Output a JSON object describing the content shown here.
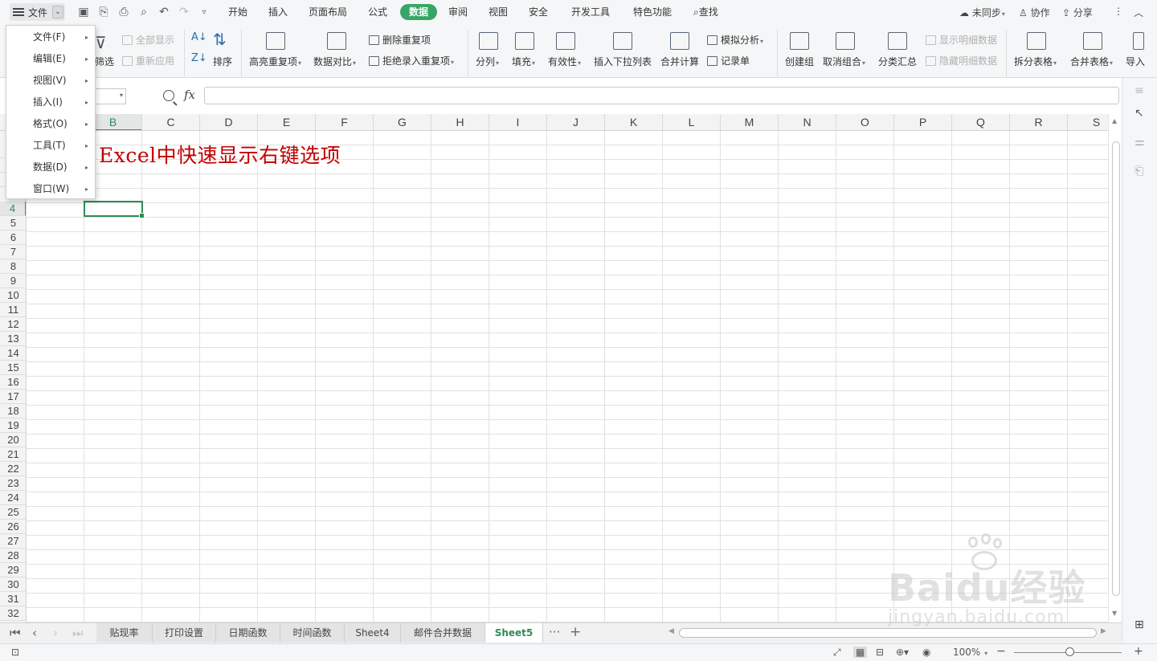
{
  "menubar": {
    "file_label": "文件",
    "tabs": [
      {
        "label": "开始",
        "active": false
      },
      {
        "label": "插入",
        "active": false
      },
      {
        "label": "页面布局",
        "active": false
      },
      {
        "label": "公式",
        "active": false
      },
      {
        "label": "数据",
        "active": true
      },
      {
        "label": "审阅",
        "active": false
      },
      {
        "label": "视图",
        "active": false
      },
      {
        "label": "安全",
        "active": false
      },
      {
        "label": "开发工具",
        "active": false
      },
      {
        "label": "特色功能",
        "active": false
      }
    ],
    "search_label": "查找",
    "sync_label": "未同步",
    "collab_label": "协作",
    "share_label": "分享"
  },
  "ribbon": {
    "filter": "筛选",
    "show_all": "全部显示",
    "reapply": "重新应用",
    "sort": "排序",
    "highlight_dup": "高亮重复项",
    "data_compare": "数据对比",
    "delete_dup": "删除重复项",
    "reject_dup": "拒绝录入重复项",
    "split_col": "分列",
    "fill": "填充",
    "validity": "有效性",
    "insert_dropdown": "插入下拉列表",
    "merge_calc": "合并计算",
    "what_if": "模拟分析",
    "record_form": "记录单",
    "create_group": "创建组",
    "ungroup": "取消组合",
    "subtotal": "分类汇总",
    "show_detail": "显示明细数据",
    "hide_detail": "隐藏明细数据",
    "split_table": "拆分表格",
    "merge_table": "合并表格",
    "import": "导入"
  },
  "formula_bar": {
    "fx_label": "fx",
    "value": ""
  },
  "grid": {
    "columns": [
      "B",
      "C",
      "D",
      "E",
      "F",
      "G",
      "H",
      "I",
      "J",
      "K",
      "L",
      "M",
      "N",
      "O",
      "P",
      "Q",
      "R",
      "S"
    ],
    "selected_column": "B",
    "rows": [
      "4",
      "5",
      "6",
      "7",
      "8",
      "9",
      "10",
      "11",
      "12",
      "13",
      "14",
      "15",
      "16",
      "17",
      "18",
      "19",
      "20",
      "21",
      "22",
      "23",
      "24",
      "25",
      "26",
      "27",
      "28",
      "29",
      "30",
      "31",
      "32"
    ],
    "selected_row": "4",
    "title_text": "Excel中快速显示右键选项",
    "title_color": "#c00000"
  },
  "context_menu": {
    "items": [
      {
        "label": "文件(F)"
      },
      {
        "label": "编辑(E)"
      },
      {
        "label": "视图(V)"
      },
      {
        "label": "插入(I)"
      },
      {
        "label": "格式(O)"
      },
      {
        "label": "工具(T)"
      },
      {
        "label": "数据(D)"
      },
      {
        "label": "窗口(W)"
      }
    ]
  },
  "sheets": {
    "tabs": [
      "贴现率",
      "打印设置",
      "日期函数",
      "时间函数",
      "Sheet4",
      "邮件合并数据",
      "Sheet5"
    ],
    "active": "Sheet5",
    "more_label": "···",
    "add_label": "+"
  },
  "statusbar": {
    "zoom": "100%"
  },
  "watermark": {
    "brand": "Baidu经验",
    "url": "jingyan.baidu.com"
  },
  "colors": {
    "accent": "#36a664",
    "selection": "#2f8c55"
  }
}
